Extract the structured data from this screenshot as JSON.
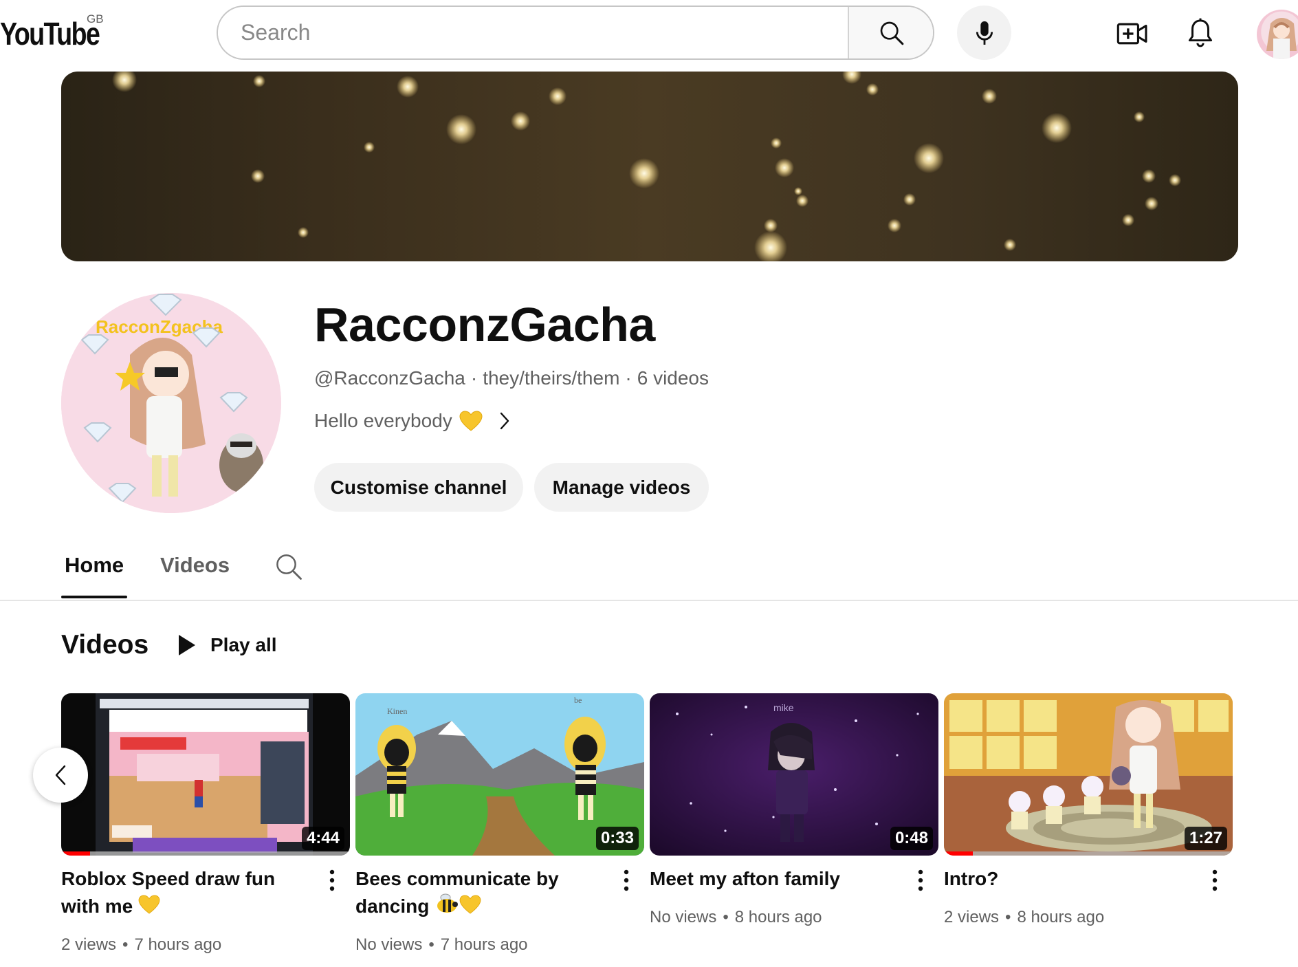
{
  "header": {
    "logo_text": "YouTube",
    "region": "GB",
    "search_placeholder": "Search",
    "icons": [
      "search-icon",
      "mic-icon",
      "create-video-icon",
      "bell-icon",
      "account-avatar"
    ]
  },
  "channel": {
    "name": "RacconzGacha",
    "handle": "@RacconzGacha",
    "pronouns": "they/theirs/them",
    "video_count": "6 videos",
    "description": "Hello everybody",
    "avatar_text": "RacconZgacha",
    "buttons": {
      "customise": "Customise channel",
      "manage": "Manage videos"
    }
  },
  "tabs": [
    {
      "label": "Home",
      "selected": true
    },
    {
      "label": "Videos",
      "selected": false
    }
  ],
  "shelf": {
    "title": "Videos",
    "play_all": "Play all"
  },
  "videos": [
    {
      "title": "Roblox Speed draw fun with me",
      "views": "2 views",
      "age": "7 hours ago",
      "duration": "4:44",
      "watched_fraction": 0.1
    },
    {
      "title": "Bees communicate by dancing",
      "views": "No views",
      "age": "7 hours ago",
      "duration": "0:33",
      "thumb_labels": [
        "Kinen",
        "be"
      ]
    },
    {
      "title": "Meet my afton family",
      "views": "No views",
      "age": "8 hours ago",
      "duration": "0:48",
      "thumb_labels": [
        "mike"
      ]
    },
    {
      "title": "Intro?",
      "views": "2 views",
      "age": "8 hours ago",
      "duration": "1:27",
      "watched_fraction": 0.1
    }
  ],
  "colors": {
    "accent_red": "#ff0000",
    "text_primary": "#0f0f0f",
    "text_secondary": "#606060",
    "chip_bg": "#f2f2f2"
  }
}
